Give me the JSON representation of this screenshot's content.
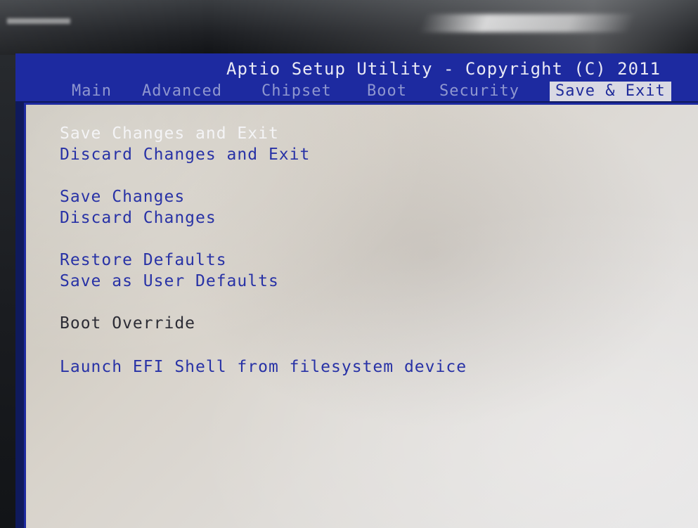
{
  "title": "Aptio Setup Utility - Copyright (C) 2011",
  "tabs": [
    {
      "label": "Main"
    },
    {
      "label": "Advanced"
    },
    {
      "label": "Chipset"
    },
    {
      "label": "Boot"
    },
    {
      "label": "Security"
    },
    {
      "label": "Save & Exit"
    }
  ],
  "active_tab": "Save & Exit",
  "menu": {
    "save_changes_and_exit": "Save Changes and Exit",
    "discard_changes_and_exit": "Discard Changes and Exit",
    "save_changes": "Save Changes",
    "discard_changes": "Discard Changes",
    "restore_defaults": "Restore Defaults",
    "save_as_user_defaults": "Save as User Defaults",
    "boot_override": "Boot Override",
    "launch_efi_shell": "Launch EFI Shell from filesystem device"
  },
  "colors": {
    "title_bar": "#1d2aa0",
    "active_tab_bg": "#d9d9e3",
    "menu_text": "#2832a6",
    "selected_text": "#f4f4f6"
  }
}
